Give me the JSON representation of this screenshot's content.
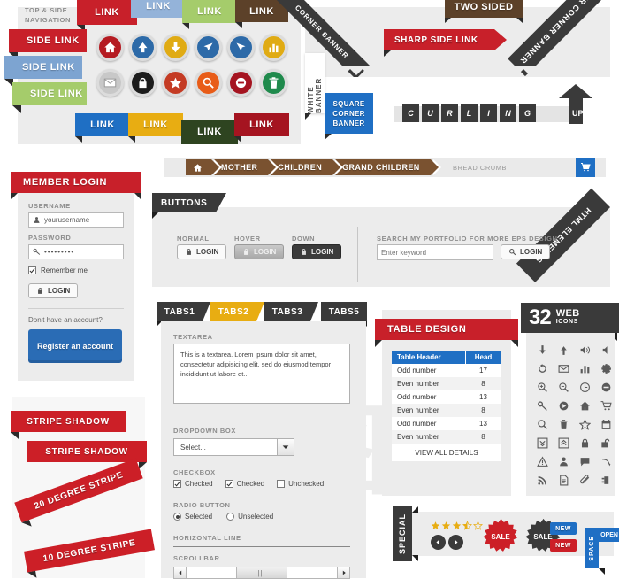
{
  "nav": {
    "section_label": "TOP & SIDE NAVIGATION",
    "top_links": [
      {
        "label": "LINK",
        "color": "#c8202a"
      },
      {
        "label": "LINK",
        "color": "#94b3d9"
      },
      {
        "label": "LINK",
        "color": "#a5cc6b"
      },
      {
        "label": "LINK",
        "color": "#5c4129"
      }
    ],
    "side_links": [
      {
        "label": "SIDE LINK",
        "color": "#c8202a"
      },
      {
        "label": "SIDE LINK",
        "color": "#7da4d1"
      },
      {
        "label": "SIDE LINK",
        "color": "#a5cc6b"
      }
    ],
    "bottom_links": [
      {
        "label": "LINK",
        "color": "#1f6fc4"
      },
      {
        "label": "LINK",
        "color": "#e8ad12"
      },
      {
        "label": "LINK",
        "color": "#2e4420"
      },
      {
        "label": "LINK",
        "color": "#a51420"
      }
    ],
    "sharp_side_link": "SHARP SIDE LINK",
    "two_sided": "TWO SIDED"
  },
  "icon_buttons": {
    "row1": [
      {
        "icon": "home-icon",
        "color": "#b51b22"
      },
      {
        "icon": "arrow-up-icon",
        "color": "#2d6aa8"
      },
      {
        "icon": "arrow-down-icon",
        "color": "#e0ab14"
      },
      {
        "icon": "cursor-left-icon",
        "color": "#2d6aa8"
      },
      {
        "icon": "cursor-right-icon",
        "color": "#2d6aa8"
      },
      {
        "icon": "chart-icon",
        "color": "#e0ab14"
      }
    ],
    "row2": [
      {
        "icon": "mail-icon",
        "color": "#c8c8c8"
      },
      {
        "icon": "lock-icon",
        "color": "#1c1c1c"
      },
      {
        "icon": "star-icon",
        "color": "#c43b24"
      },
      {
        "icon": "search-icon",
        "color": "#e85c18"
      },
      {
        "icon": "minus-circle-icon",
        "color": "#a51420"
      },
      {
        "icon": "trash-icon",
        "color": "#1f8a4c"
      }
    ]
  },
  "banners": {
    "corner_banner": "CORNER BANNER",
    "bigger_corner_banner": "BIGGER CORNER BANNER",
    "white_banner": "WHITE BANNER",
    "square_corner_banner": "SQUARE CORNER BANNER",
    "curling_letters": [
      "C",
      "U",
      "R",
      "L",
      "I",
      "N",
      "G"
    ],
    "curling_up": "UP"
  },
  "breadcrumb": {
    "home_icon": "home-icon",
    "items": [
      "MOTHER",
      "CHILDREN",
      "GRAND CHILDREN"
    ],
    "trail_label": "BREAD CRUMB",
    "cart_icon": "cart-icon"
  },
  "member_login": {
    "title": "MEMBER LOGIN",
    "username_label": "USERNAME",
    "username_value": "yourusername",
    "username_icon": "user-icon",
    "password_label": "PASSWORD",
    "password_value": "•••••••••",
    "password_icon": "key-icon",
    "remember_label": "Remember me",
    "remember_checked": true,
    "login_button": "LOGIN",
    "login_icon": "lock-icon",
    "no_account_text": "Don't have an account?",
    "register_button": "Register an account"
  },
  "buttons_panel": {
    "flag_label": "BUTTONS",
    "states": [
      {
        "caption": "NORMAL",
        "label": "LOGIN",
        "state": "normal"
      },
      {
        "caption": "HOVER",
        "label": "LOGIN",
        "state": "hover"
      },
      {
        "caption": "DOWN",
        "label": "LOGIN",
        "state": "down"
      }
    ],
    "search_caption": "SEARCH MY PORTFOLIO FOR MORE EPS DESIGN",
    "search_placeholder": "Enter keyword",
    "search_button": "LOGIN",
    "search_icon": "search-icon",
    "corner_banner": "HTML ELEMENTS"
  },
  "tabs_panel": {
    "tabs": [
      {
        "label": "TABS1",
        "active": false
      },
      {
        "label": "TABS2",
        "active": true
      },
      {
        "label": "TABS3",
        "active": false
      },
      {
        "label": "TABS5",
        "active": false
      }
    ],
    "textarea_label": "TEXTAREA",
    "textarea_value": "This is a textarea. Lorem ipsum dolor sit amet, consectetur adipisicing elit, sed do eiusmod tempor incididunt ut labore et...",
    "dropdown_label": "DROPDOWN BOX",
    "dropdown_value": "Select...",
    "checkbox_label": "CHECKBOX",
    "checkboxes": [
      {
        "label": "Checked",
        "checked": true
      },
      {
        "label": "Checked",
        "checked": true
      },
      {
        "label": "Unchecked",
        "checked": false
      }
    ],
    "radio_label": "RADIO BUTTON",
    "radios": [
      {
        "label": "Selected",
        "selected": true
      },
      {
        "label": "Unselected",
        "selected": false
      }
    ],
    "hr_label": "HORIZONTAL LINE",
    "scrollbar_label": "SCROLLBAR"
  },
  "table_panel": {
    "title": "TABLE DESIGN",
    "headers": [
      "Table Header",
      "Head"
    ],
    "rows": [
      [
        "Odd number",
        "17"
      ],
      [
        "Even number",
        "8"
      ],
      [
        "Odd number",
        "13"
      ],
      [
        "Even number",
        "8"
      ],
      [
        "Odd number",
        "13"
      ],
      [
        "Even number",
        "8"
      ]
    ],
    "footer_link": "VIEW ALL DETAILS"
  },
  "icons_panel": {
    "count": "32",
    "title_line1": "WEB",
    "title_line2": "ICONS",
    "icons": [
      "download-icon",
      "upload-icon",
      "volume-icon",
      "mute-icon",
      "refresh-icon",
      "mail-icon",
      "chart-icon",
      "gear-icon",
      "zoom-in-icon",
      "zoom-out-icon",
      "clock-icon",
      "minus-circle-icon",
      "key-icon",
      "play-icon",
      "home-icon",
      "cart-icon",
      "search-icon",
      "trash-icon",
      "star-icon",
      "calendar-icon",
      "chevron-down-box-icon",
      "chevron-up-box-icon",
      "lock-icon",
      "unlock-icon",
      "warning-icon",
      "user-icon",
      "comment-icon",
      "reply-icon",
      "rss-icon",
      "document-icon",
      "attach-icon",
      "plug-icon"
    ]
  },
  "stripes": {
    "items": [
      {
        "label": "STRIPE SHADOW",
        "angle": 0,
        "fold": "left"
      },
      {
        "label": "STRIPE SHADOW",
        "angle": 0,
        "fold": "right"
      },
      {
        "label": "20 DEGREE STRIPE",
        "angle": -20,
        "fold": "left"
      },
      {
        "label": "10 DEGREE STRIPE",
        "angle": -10,
        "fold": "left"
      }
    ]
  },
  "special_panel": {
    "flag_label": "SPECIAL",
    "rating": 3.5,
    "rating_max": 5,
    "prev_icon": "chevron-left-icon",
    "next_icon": "chevron-right-icon",
    "sale_badges": [
      {
        "label": "SALE",
        "color": "#cc1f27"
      },
      {
        "label": "SALE",
        "color": "#3a3a3a"
      }
    ],
    "new_badges": [
      {
        "label": "NEW",
        "color": "#1f6fc4"
      },
      {
        "label": "NEW",
        "color": "#cc1f27"
      }
    ],
    "space_label": "SPACE",
    "open_label": "OPEN"
  },
  "colors": {
    "red": "#c8202a",
    "dark_red": "#cc1f27",
    "blue": "#1f6fc4",
    "yellow": "#e8ad12",
    "green": "#a5cc6b",
    "brown": "#5c4129",
    "dark": "#3a3a3a",
    "panel_gray": "#ececec"
  }
}
